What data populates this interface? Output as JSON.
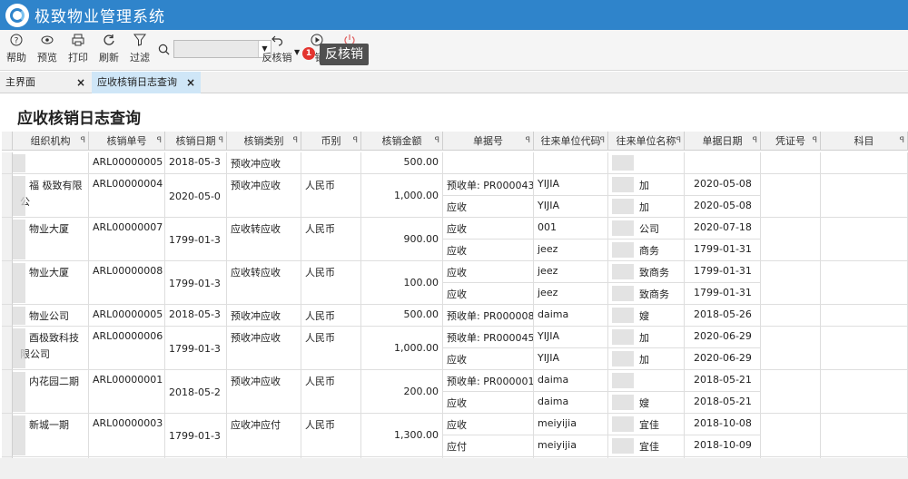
{
  "app": {
    "title": "极致物业管理系统"
  },
  "toolbar": {
    "help": "帮助",
    "preview": "预览",
    "print": "打印",
    "refresh": "刷新",
    "filter": "过滤",
    "reverse": "反核销",
    "reverse_tooltip": "反核销",
    "badge_count": "1",
    "clipped_label": "销"
  },
  "tabs": [
    {
      "label": "主界面"
    },
    {
      "label": "应收核销日志查询"
    }
  ],
  "page": {
    "heading": "应收核销日志查询"
  },
  "columns": [
    "组织机构",
    "核销单号",
    "核销日期",
    "核销类别",
    "币别",
    "核销金额",
    "单据号",
    "往来单位代码",
    "往来单位名称",
    "单据日期",
    "凭证号",
    "科目"
  ],
  "rows": [
    {
      "org": "",
      "no": "ARL00000005",
      "date": "2018-05-3",
      "type": "预收冲应收",
      "cur": "",
      "amount": "500.00",
      "lines": [
        {
          "doc": "",
          "code": "",
          "name": "",
          "ddate": ""
        }
      ]
    },
    {
      "org": "福 极致有限",
      "org2": "公",
      "no": "ARL00000004",
      "date": "2020-05-0",
      "type": "预收冲应收",
      "cur": "人民币",
      "amount": "1,000.00",
      "lines": [
        {
          "doc": "预收单: PR000043",
          "code": "YIJIA",
          "name": "加",
          "ddate": "2020-05-08"
        },
        {
          "doc": "应收",
          "code": "YIJIA",
          "name": "加",
          "ddate": "2020-05-08"
        }
      ]
    },
    {
      "org": "物业大厦",
      "no": "ARL00000007",
      "date": "1799-01-3",
      "type": "应收转应收",
      "cur": "人民币",
      "amount": "900.00",
      "lines": [
        {
          "doc": "应收",
          "code": "001",
          "name": "公司",
          "ddate": "2020-07-18"
        },
        {
          "doc": "应收",
          "code": "jeez",
          "name": "商务",
          "ddate": "1799-01-31"
        }
      ]
    },
    {
      "org": "物业大厦",
      "no": "ARL00000008",
      "date": "1799-01-3",
      "type": "应收转应收",
      "cur": "人民币",
      "amount": "100.00",
      "lines": [
        {
          "doc": "应收",
          "code": "jeez",
          "name": "致商务",
          "ddate": "1799-01-31"
        },
        {
          "doc": "应收",
          "code": "jeez",
          "name": "致商务",
          "ddate": "1799-01-31"
        }
      ]
    },
    {
      "org": "物业公司",
      "no": "ARL00000005",
      "date": "2018-05-3",
      "type": "预收冲应收",
      "cur": "人民币",
      "amount": "500.00",
      "lines": [
        {
          "doc": "预收单: PR000008",
          "code": "daima",
          "name": "嫂",
          "ddate": "2018-05-26"
        }
      ]
    },
    {
      "org": "酉极致科技",
      "org2": "限公司",
      "no": "ARL00000006",
      "date": "1799-01-3",
      "type": "预收冲应收",
      "cur": "人民币",
      "amount": "1,000.00",
      "lines": [
        {
          "doc": "预收单: PR000045",
          "code": "YIJIA",
          "name": "加",
          "ddate": "2020-06-29"
        },
        {
          "doc": "应收",
          "code": "YIJIA",
          "name": "加",
          "ddate": "2020-06-29"
        }
      ]
    },
    {
      "org": "内花园二期",
      "no": "ARL00000001",
      "date": "2018-05-2",
      "type": "预收冲应收",
      "cur": "人民币",
      "amount": "200.00",
      "lines": [
        {
          "doc": "预收单: PR000001",
          "code": "daima",
          "name": "",
          "ddate": "2018-05-21"
        },
        {
          "doc": "应收",
          "code": "daima",
          "name": "嫂",
          "ddate": "2018-05-21"
        }
      ]
    },
    {
      "org": "新城一期",
      "no": "ARL00000003",
      "date": "1799-01-3",
      "type": "应收冲应付",
      "cur": "人民币",
      "amount": "1,300.00",
      "lines": [
        {
          "doc": "应收",
          "code": "meiyijia",
          "name": "宜佳",
          "ddate": "2018-10-08"
        },
        {
          "doc": "应付",
          "code": "meiyijia",
          "name": "宜佳",
          "ddate": "2018-10-09"
        }
      ]
    }
  ]
}
